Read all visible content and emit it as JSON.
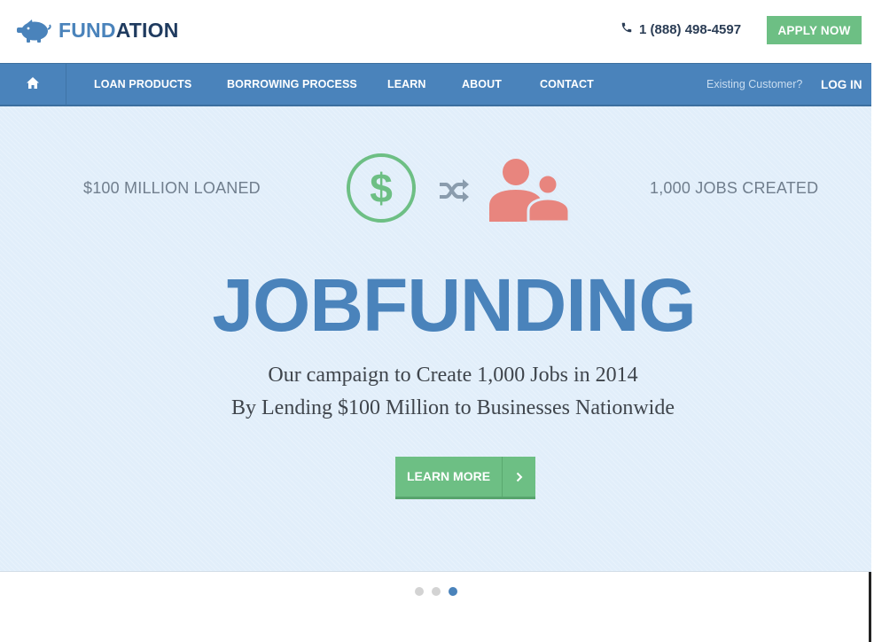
{
  "header": {
    "logo": {
      "part1": "FUND",
      "part2": "ATION",
      "icon": "piggy-bank-icon"
    },
    "phone": {
      "icon": "phone-icon",
      "number": "1 (888) 498-4597"
    },
    "apply_label": "APPLY NOW"
  },
  "nav": {
    "home_icon": "home-icon",
    "items": [
      {
        "label": "LOAN PRODUCTS"
      },
      {
        "label": "BORROWING PROCESS"
      },
      {
        "label": "LEARN"
      },
      {
        "label": "ABOUT"
      },
      {
        "label": "CONTACT"
      }
    ],
    "existing_customer": "Existing Customer?",
    "login_label": "LOG IN"
  },
  "hero": {
    "stat_left": "$100 MILLION LOANED",
    "stat_right": "1,000 JOBS CREATED",
    "title": "JOBFUNDING",
    "subtitle_line1": "Our campaign to Create 1,000 Jobs in 2014",
    "subtitle_line2": "By Lending $100 Million to Businesses Nationwide",
    "cta_label": "LEARN MORE",
    "icons": [
      "dollar-circle-icon",
      "shuffle-icon",
      "people-icon",
      "chevron-right-icon"
    ]
  },
  "carousel": {
    "total": 3,
    "active_index": 2
  },
  "colors": {
    "brand_blue": "#4a83bb",
    "brand_dark": "#1f3b5f",
    "green": "#6dbf84",
    "coral": "#e8857e",
    "hero_bg": "#e1eefa"
  }
}
